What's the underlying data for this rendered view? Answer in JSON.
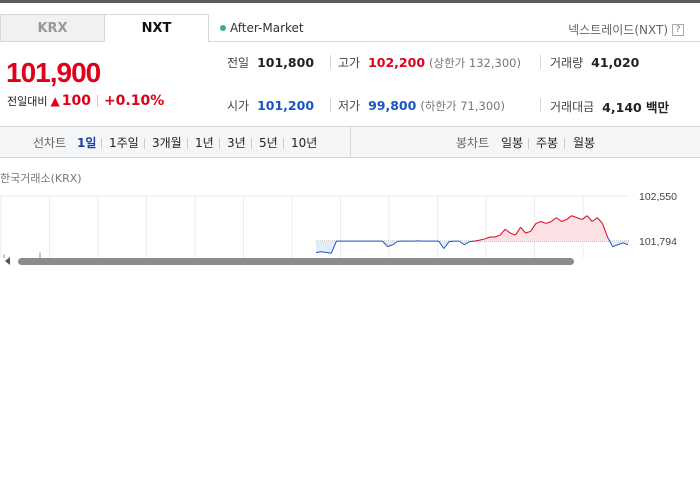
{
  "tabs": [
    {
      "label": "KRX",
      "active": false
    },
    {
      "label": "NXT",
      "active": true
    }
  ],
  "session_label": "After-Market",
  "nxt_link": {
    "label": "넥스트레이드(NXT)",
    "help": "?"
  },
  "price": {
    "current": "101,900",
    "change_label": "전일대비",
    "change_amount": "100",
    "change_percent": "+0.10%"
  },
  "stats": {
    "prev_close": {
      "label": "전일",
      "value": "101,800"
    },
    "high": {
      "label": "고가",
      "value": "102,200",
      "sub": "(상한가 132,300)"
    },
    "volume": {
      "label": "거래량",
      "value": "41,020"
    },
    "open": {
      "label": "시가",
      "value": "101,200"
    },
    "low": {
      "label": "저가",
      "value": "99,800",
      "sub": "(하한가 71,300)"
    },
    "trade_value": {
      "label": "거래대금",
      "value": "4,140 백만"
    }
  },
  "toolbar": {
    "line_chart_label": "선차트",
    "line_periods": [
      "1일",
      "1주일",
      "3개월",
      "1년",
      "3년",
      "5년",
      "10년"
    ],
    "active_period": "1일",
    "candle_chart_label": "봉차트",
    "candle_periods": [
      "일봉",
      "주봉",
      "월봉"
    ]
  },
  "chart_title": "한국거래소(KRX)",
  "colors": {
    "up": "#e0001b",
    "down": "#1a55c4",
    "accent": "#1a3fa4"
  },
  "chart_data": {
    "type": "line",
    "title": "",
    "y_tick_labels": [
      "102,550",
      "101,794"
    ],
    "reference_value": 101794,
    "ylim": [
      101100,
      102700
    ],
    "grid": true,
    "series": [
      {
        "values": [
          101500,
          101520,
          101500,
          101480,
          101794,
          101794,
          101794,
          101794,
          101794,
          101794,
          101794,
          101794,
          101794,
          101794,
          101650,
          101700,
          101790,
          101794,
          101794,
          101794,
          101800,
          101794,
          101794,
          101794,
          101794,
          101600,
          101780,
          101794,
          101794,
          101700,
          101780,
          101794,
          101820,
          101850,
          101900,
          101900,
          101950,
          102100,
          102000,
          101950,
          102150,
          102000,
          102050,
          102250,
          102300,
          102250,
          102300,
          102400,
          102300,
          102350,
          102450,
          102400,
          102350,
          102450,
          102300,
          102400,
          102250,
          101900,
          101650,
          101700,
          101750,
          101700
        ]
      }
    ]
  }
}
